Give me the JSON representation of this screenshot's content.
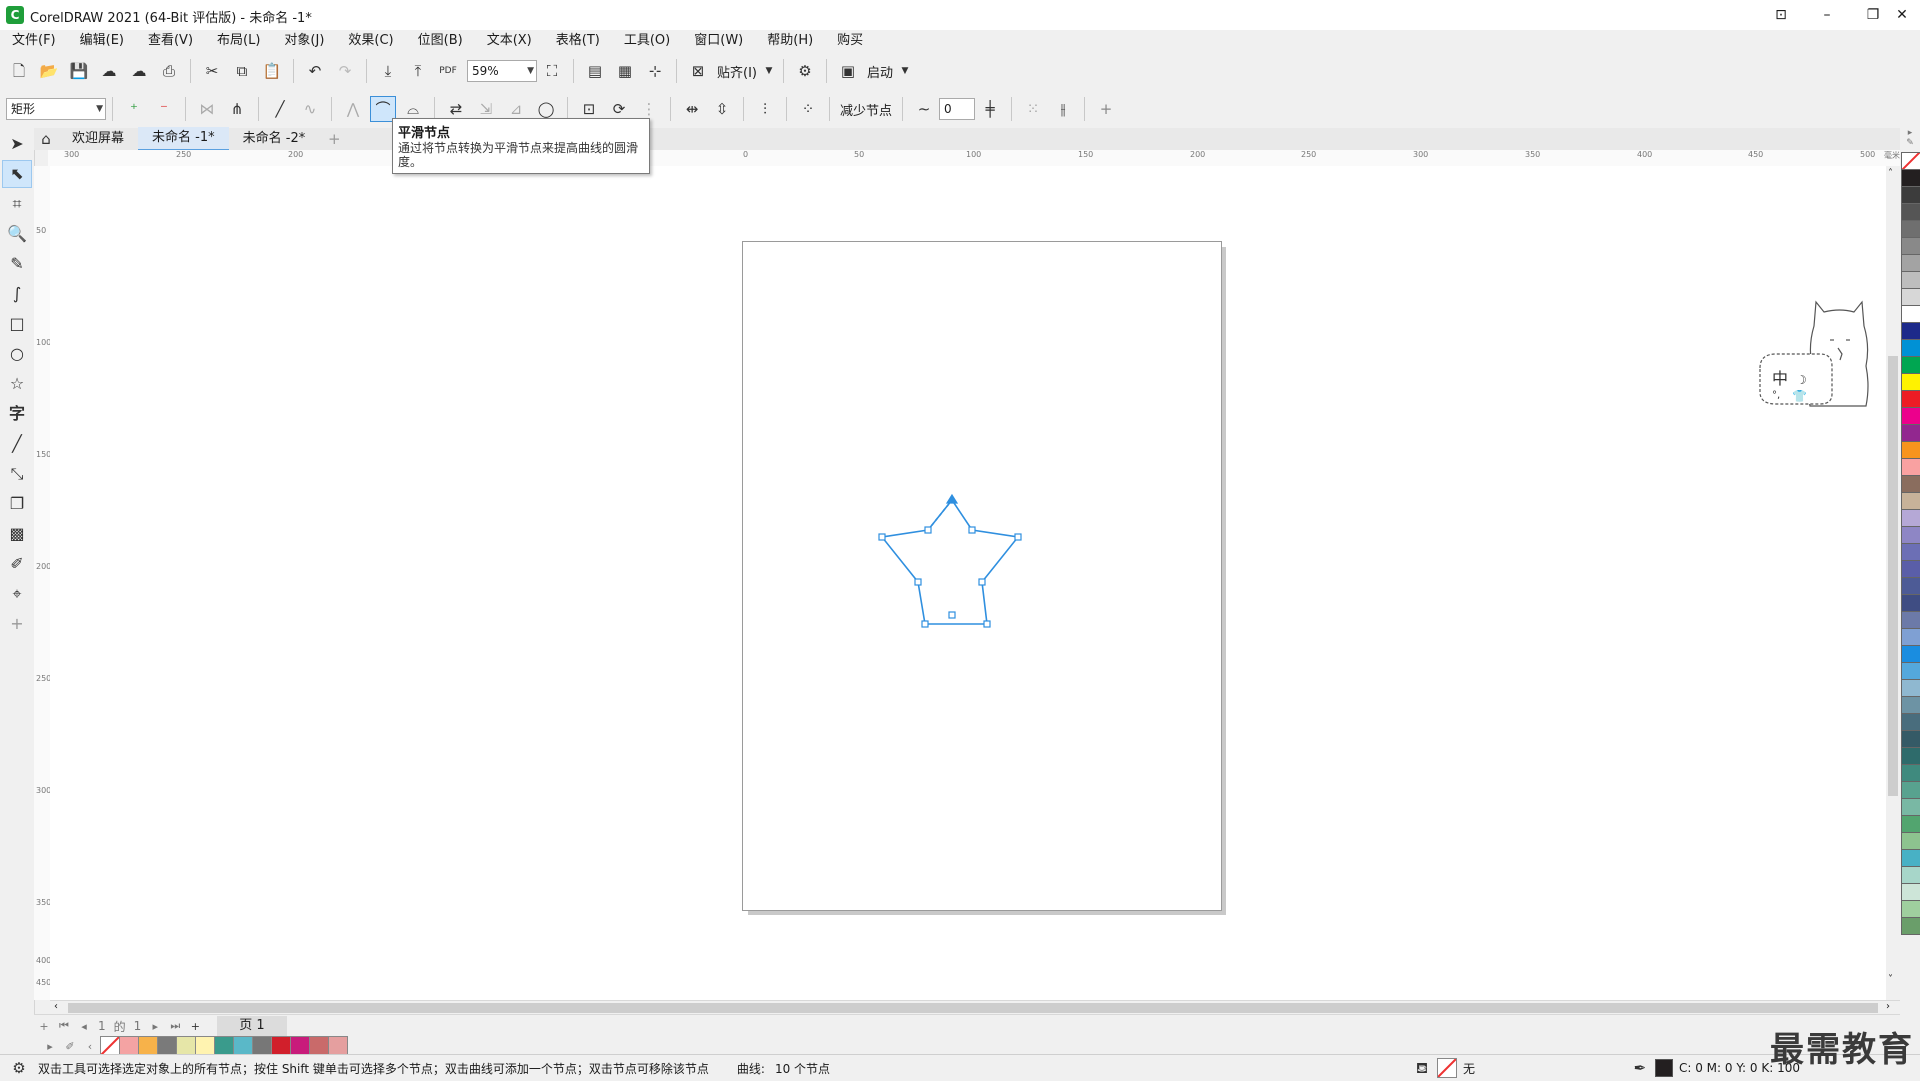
{
  "window": {
    "title": "CorelDRAW 2021 (64-Bit 评估版) - 未命名 -1*"
  },
  "menu": [
    "文件(F)",
    "编辑(E)",
    "查看(V)",
    "布局(L)",
    "对象(J)",
    "效果(C)",
    "位图(B)",
    "文本(X)",
    "表格(T)",
    "工具(O)",
    "窗口(W)",
    "帮助(H)",
    "购买"
  ],
  "standard_toolbar": {
    "zoom": "59%",
    "snap_label": "贴齐(I)",
    "launch_label": "启动"
  },
  "property_bar": {
    "object_type": "矩形",
    "reduce_nodes_label": "减少节点",
    "curve_smoothness": "0"
  },
  "document_tabs": [
    {
      "label": "欢迎屏幕"
    },
    {
      "label": "未命名 -1*"
    },
    {
      "label": "未命名 -2*"
    }
  ],
  "tooltip": {
    "title": "平滑节点",
    "description": "通过将节点转换为平滑节点来提高曲线的圆滑度。"
  },
  "ruler": {
    "top_labels": [
      "300",
      "250",
      "200",
      "0",
      "50",
      "100",
      "150",
      "200",
      "250",
      "300",
      "350",
      "400",
      "450",
      "500"
    ],
    "unit": "毫米",
    "left_labels": [
      "50",
      "100",
      "150",
      "200",
      "250",
      "300",
      "350",
      "400",
      "450"
    ]
  },
  "page_nav": {
    "current": "1",
    "of": "的",
    "total": "1",
    "page_tab": "页 1"
  },
  "status": {
    "hint": "双击工具可选择选定对象上的所有节点；按住 Shift 键单击可选择多个节点；双击曲线可添加一个节点；双击节点可移除该节点",
    "curve_label": "曲线:",
    "curve_info": "10 个节点",
    "fill": "无",
    "cmyk": "C: 0 M: 0 Y: 0 K: 100"
  },
  "ime": {
    "label": "中"
  },
  "watermark": "最需教育",
  "colors": {
    "accent": "#3b8fd8",
    "star_stroke": "#2f8fdf",
    "palette_right": [
      "#231f20",
      "#3c3c3c",
      "#555555",
      "#6f6f6f",
      "#898989",
      "#a3a3a3",
      "#bdbdbd",
      "#d7d7d7",
      "#ffffff",
      "#1d2a8a",
      "#0091d5",
      "#00a651",
      "#fff200",
      "#ed1c24",
      "#ec008c",
      "#92278f",
      "#f7941d",
      "#f9a1a1",
      "#8a6d5e",
      "#c7b299",
      "#b5a8d6",
      "#8e86c5",
      "#6c6fb5",
      "#5a5ea8",
      "#4d5b96",
      "#3f4d83",
      "#6c7aa8",
      "#7fa0d3",
      "#1a8de0",
      "#54a8dc",
      "#8fb8d0",
      "#6d93a4",
      "#496d7d",
      "#355a66",
      "#2e6b6b",
      "#3f8a7e",
      "#58a28f",
      "#79b8a4",
      "#52a56f",
      "#8dc38f",
      "#48b1c5",
      "#a7d6c9",
      "#cde5d8",
      "#9fcf9e",
      "#6a9e6a"
    ],
    "palette_bottom": [
      "#f4a3a3",
      "#f7b24a",
      "#7a7a7a",
      "#e6e6a8",
      "#fff3b0",
      "#3a9b8c",
      "#5ab8c8",
      "#777777",
      "#d11f2b",
      "#c81c7b",
      "#c96a6a",
      "#e59f9f"
    ]
  }
}
